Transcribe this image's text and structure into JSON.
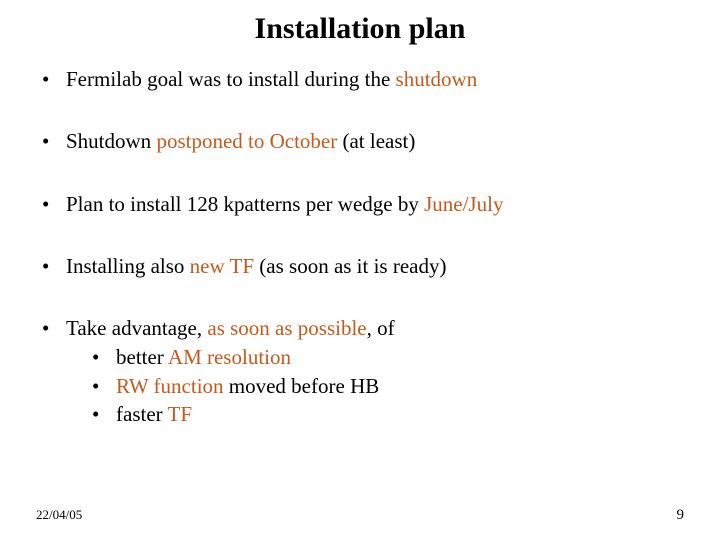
{
  "title": "Installation plan",
  "bullets": {
    "b1_a": "Fermilab goal was to install during the ",
    "b1_b": "shutdown",
    "b2_a": "Shutdown ",
    "b2_b": "postponed to October",
    "b2_c": " (at least)",
    "b3_a": "Plan to install 128 kpatterns per wedge by ",
    "b3_b": "June/July",
    "b4_a": "Installing also ",
    "b4_b": "new TF",
    "b4_c": " (as soon as it is ready)",
    "b5_a": "Take advantage, ",
    "b5_b": "as soon as possible",
    "b5_c": ", of",
    "s1_a": "better ",
    "s1_b": "AM resolution",
    "s2_a": "RW function",
    "s2_b": " moved before HB",
    "s3_a": "faster ",
    "s3_b": "TF"
  },
  "footer": {
    "date": "22/04/05",
    "page": "9"
  }
}
